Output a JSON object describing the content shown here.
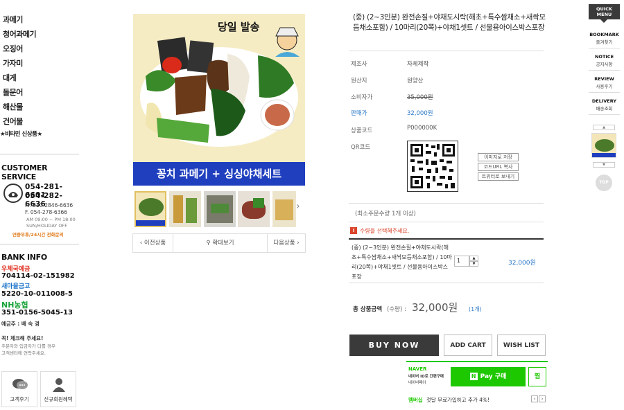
{
  "sidebar": {
    "categories": [
      "과메기",
      "청어과메기",
      "오징어",
      "가자미",
      "대게",
      "돌문어",
      "해산물",
      "건어물",
      "★비타민 신상품★"
    ],
    "customer_service": {
      "title": "CUSTOMER SERVICE",
      "phone1": "054-281-6601",
      "phone2": "054-282-6636",
      "mobile": "M. 010-2846-6636",
      "fax": "F. 054-278-6366",
      "hours": "AM 09:00 ~ PM 18:00",
      "holiday": "SUN/HOLIDAY OFF",
      "note": "연중무휴/24시간 전화문의"
    },
    "bank": {
      "title": "BANK INFO",
      "banks": [
        {
          "name": "우체국예금",
          "account": "704114-02-151982",
          "color": "#e03020"
        },
        {
          "name": "새마을금고",
          "account": "5220-10-011008-5",
          "color": "#1a73c9"
        },
        {
          "name": "NH농협",
          "account": "351-0156-5045-13",
          "color": "#1aa33a"
        }
      ],
      "holder": "예금주 : 배 숙 경",
      "check_title": "꼭! 체크해 주세요!",
      "check_line1": "주문자와 입금자가 다를 경우",
      "check_line2": "고객센터에 연락주세요."
    },
    "buttons": {
      "review": "고객후기",
      "signup": "신규회원혜택"
    }
  },
  "product_image": {
    "badge": "당일 발송",
    "banner": "꽁치 과메기 + 싱싱야채세트",
    "prev": "이전상품",
    "zoom": "확대보기",
    "next": "다음상품"
  },
  "product": {
    "title": "(중) (2~3인분) 완전손질+야채도시락(해초+특수쌈채소+새싹모듬채소포함) / 10마리(20쪽)+야채1셋트 / 선물용아이스박스포장",
    "labels": {
      "maker": "제조사",
      "origin": "원산지",
      "consumer_price": "소비자가",
      "sale_price": "판매가",
      "code": "상품코드",
      "qr": "QR코드"
    },
    "values": {
      "maker": "자체제작",
      "origin": "원양산",
      "consumer_price": "35,000원",
      "sale_price": "32,000원",
      "code": "P000000K"
    },
    "qr_buttons": [
      "이미지로 저장",
      "코드URL 복사",
      "트위터로 보내기"
    ],
    "min_order": "(최소주문수량 1개 이상)",
    "warning": "수량을 선택해주세요.",
    "option_text": "(중) (2~3인분) 완전손질+야채도시락(해초+특수쌈채소+새싹모듬채소포함) / 10마리(20쪽)+야채1셋트 / 선물용아이스박스포장",
    "quantity": "1",
    "option_price": "32,000원",
    "total_label": "총 상품금액",
    "total_sub": "(수량) :",
    "total_price": "32,000원",
    "total_count": "(1개)",
    "buy_now": "BUY NOW",
    "add_cart": "ADD CART",
    "wish_list": "WISH LIST",
    "naver": {
      "brand": "NAVER",
      "line1": "네이버 ID로 간편구매",
      "line2": "네이버페이",
      "pay": "Pay 구매",
      "wish": "찜",
      "promo_label": "멤버십",
      "promo": "첫달 무료가입하고 추가 4%!"
    }
  },
  "quick": {
    "title": "QUICK MENU",
    "items": [
      {
        "en": "BOOKMARK",
        "ko": "즐겨찾기"
      },
      {
        "en": "NOTICE",
        "ko": "공지사항"
      },
      {
        "en": "REVIEW",
        "ko": "사용후기"
      },
      {
        "en": "DELIVERY",
        "ko": "배송조회"
      }
    ],
    "top": "TOP"
  }
}
